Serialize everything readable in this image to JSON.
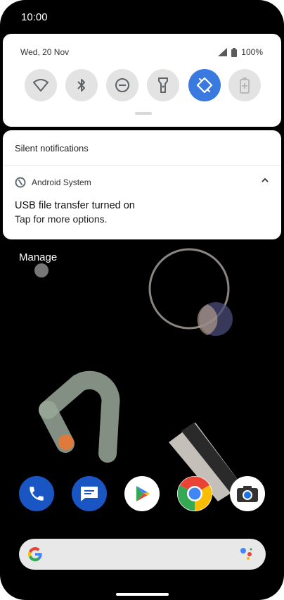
{
  "status_bar": {
    "time": "10:00"
  },
  "quick_settings": {
    "date": "Wed, 20 Nov",
    "battery": "100%",
    "tiles": [
      {
        "name": "wifi",
        "active": false
      },
      {
        "name": "bluetooth",
        "active": false
      },
      {
        "name": "do-not-disturb",
        "active": false
      },
      {
        "name": "flashlight",
        "active": false
      },
      {
        "name": "auto-rotate",
        "active": true
      },
      {
        "name": "battery-saver",
        "active": false
      }
    ]
  },
  "notifications": {
    "section_title": "Silent notifications",
    "app_name": "Android System",
    "title": "USB file transfer turned on",
    "text": "Tap for more options."
  },
  "manage_label": "Manage",
  "dock": {
    "apps": [
      "phone",
      "messages",
      "play-store",
      "chrome",
      "camera"
    ]
  },
  "colors": {
    "accent": "#3a79e0",
    "tile_inactive": "#e3e3e3",
    "background": "#000000"
  }
}
